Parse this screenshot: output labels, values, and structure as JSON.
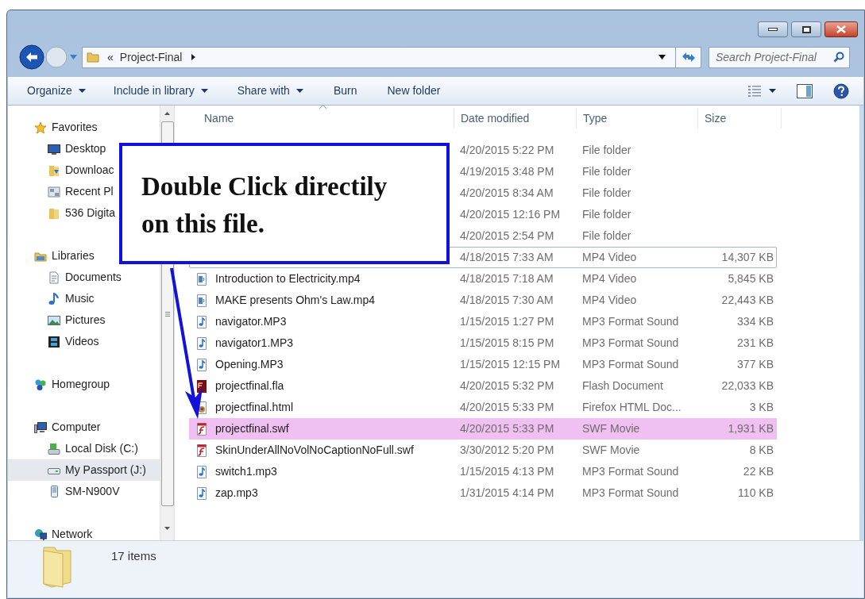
{
  "address_bar": {
    "overflow_mark": "«",
    "location": "Project-Final"
  },
  "search": {
    "placeholder": "Search Project-Final"
  },
  "toolbar": {
    "items": [
      {
        "label": "Organize",
        "dropdown": true
      },
      {
        "label": "Include in library",
        "dropdown": true
      },
      {
        "label": "Share with",
        "dropdown": true
      },
      {
        "label": "Burn",
        "dropdown": false
      },
      {
        "label": "New folder",
        "dropdown": false
      }
    ]
  },
  "sidebar": {
    "groups": [
      {
        "label": "Favorites",
        "kind": "star",
        "selected": false,
        "children": [
          {
            "label": "Desktop",
            "kind": "desktop",
            "selected": false
          },
          {
            "label": "Downloac",
            "kind": "downloads",
            "selected": false
          },
          {
            "label": "Recent Pl",
            "kind": "recent",
            "selected": false
          },
          {
            "label": "536 Digita",
            "kind": "folder",
            "selected": false
          }
        ]
      },
      {
        "label": "Libraries",
        "kind": "libraries",
        "selected": false,
        "children": [
          {
            "label": "Documents",
            "kind": "document",
            "selected": false
          },
          {
            "label": "Music",
            "kind": "music",
            "selected": false
          },
          {
            "label": "Pictures",
            "kind": "pictures",
            "selected": false
          },
          {
            "label": "Videos",
            "kind": "videos",
            "selected": false
          }
        ]
      },
      {
        "label": "Homegroup",
        "kind": "homegroup",
        "selected": false
      },
      {
        "label": "Computer",
        "kind": "computer",
        "selected": false,
        "children": [
          {
            "label": "Local Disk (C:)",
            "kind": "disk",
            "selected": false
          },
          {
            "label": "My Passport (J:)",
            "kind": "drive",
            "selected": true
          },
          {
            "label": "SM-N900V",
            "kind": "phone",
            "selected": false
          }
        ]
      },
      {
        "label": "Network",
        "kind": "network",
        "selected": false
      }
    ]
  },
  "table": {
    "columns": [
      {
        "label": "Name",
        "sorted": true
      },
      {
        "label": "Date modified",
        "sorted": false
      },
      {
        "label": "Type",
        "sorted": false
      },
      {
        "label": "Size",
        "sorted": false
      }
    ],
    "rows": [
      {
        "date": "4/20/2015 5:22 PM",
        "type": "File folder",
        "selected": false,
        "focused": false
      },
      {
        "date": "4/19/2015 3:48 PM",
        "type": "File folder",
        "selected": false,
        "focused": false
      },
      {
        "date": "4/20/2015 8:34 AM",
        "type": "File folder",
        "selected": false,
        "focused": false
      },
      {
        "date": "4/20/2015 12:16 PM",
        "type": "File folder",
        "selected": false,
        "focused": false
      },
      {
        "date": "4/20/2015 2:54 PM",
        "type": "File folder",
        "selected": false,
        "focused": false
      },
      {
        "date": "4/18/2015 7:33 AM",
        "type": "MP4 Video",
        "size": "14,307 KB",
        "selected": false,
        "focused": true
      },
      {
        "name": "Introduction to Electricity.mp4",
        "kind": "video",
        "date": "4/18/2015 7:18 AM",
        "type": "MP4 Video",
        "size": "5,845 KB",
        "selected": false,
        "focused": false
      },
      {
        "name": "MAKE presents  Ohm's Law.mp4",
        "kind": "video",
        "date": "4/18/2015 7:30 AM",
        "type": "MP4 Video",
        "size": "22,443 KB",
        "selected": false,
        "focused": false
      },
      {
        "name": "navigator.MP3",
        "kind": "audio",
        "date": "1/15/2015 1:27 PM",
        "type": "MP3 Format Sound",
        "size": "334 KB",
        "selected": false,
        "focused": false
      },
      {
        "name": "navigator1.MP3",
        "kind": "audio",
        "date": "1/15/2015 8:15 PM",
        "type": "MP3 Format Sound",
        "size": "231 KB",
        "selected": false,
        "focused": false
      },
      {
        "name": "Opening.MP3",
        "kind": "audio",
        "date": "1/15/2015 12:15 PM",
        "type": "MP3 Format Sound",
        "size": "377 KB",
        "selected": false,
        "focused": false
      },
      {
        "name": "projectfinal.fla",
        "kind": "fla",
        "date": "4/20/2015 5:32 PM",
        "type": "Flash Document",
        "size": "22,033 KB",
        "selected": false,
        "focused": false
      },
      {
        "name": "projectfinal.html",
        "kind": "html",
        "date": "4/20/2015 5:33 PM",
        "type": "Firefox HTML Doc...",
        "size": "3 KB",
        "selected": false,
        "focused": false
      },
      {
        "name": "projectfinal.swf",
        "kind": "swf",
        "date": "4/20/2015 5:33 PM",
        "type": "SWF Movie",
        "size": "1,931 KB",
        "selected": true,
        "focused": false
      },
      {
        "name": "SkinUnderAllNoVolNoCaptionNoFull.swf",
        "kind": "swf",
        "date": "3/30/2012 5:20 PM",
        "type": "SWF Movie",
        "size": "8 KB",
        "selected": false,
        "focused": false
      },
      {
        "name": "switch1.mp3",
        "kind": "audio",
        "date": "1/15/2015 4:13 PM",
        "type": "MP3 Format Sound",
        "size": "22 KB",
        "selected": false,
        "focused": false
      },
      {
        "name": "zap.mp3",
        "kind": "audio",
        "date": "1/31/2015 4:14 PM",
        "type": "MP3 Format Sound",
        "size": "110 KB",
        "selected": false,
        "focused": false
      }
    ]
  },
  "callout": {
    "text": "Double Click directily on this file."
  },
  "status_bar": {
    "count": "17 items"
  }
}
